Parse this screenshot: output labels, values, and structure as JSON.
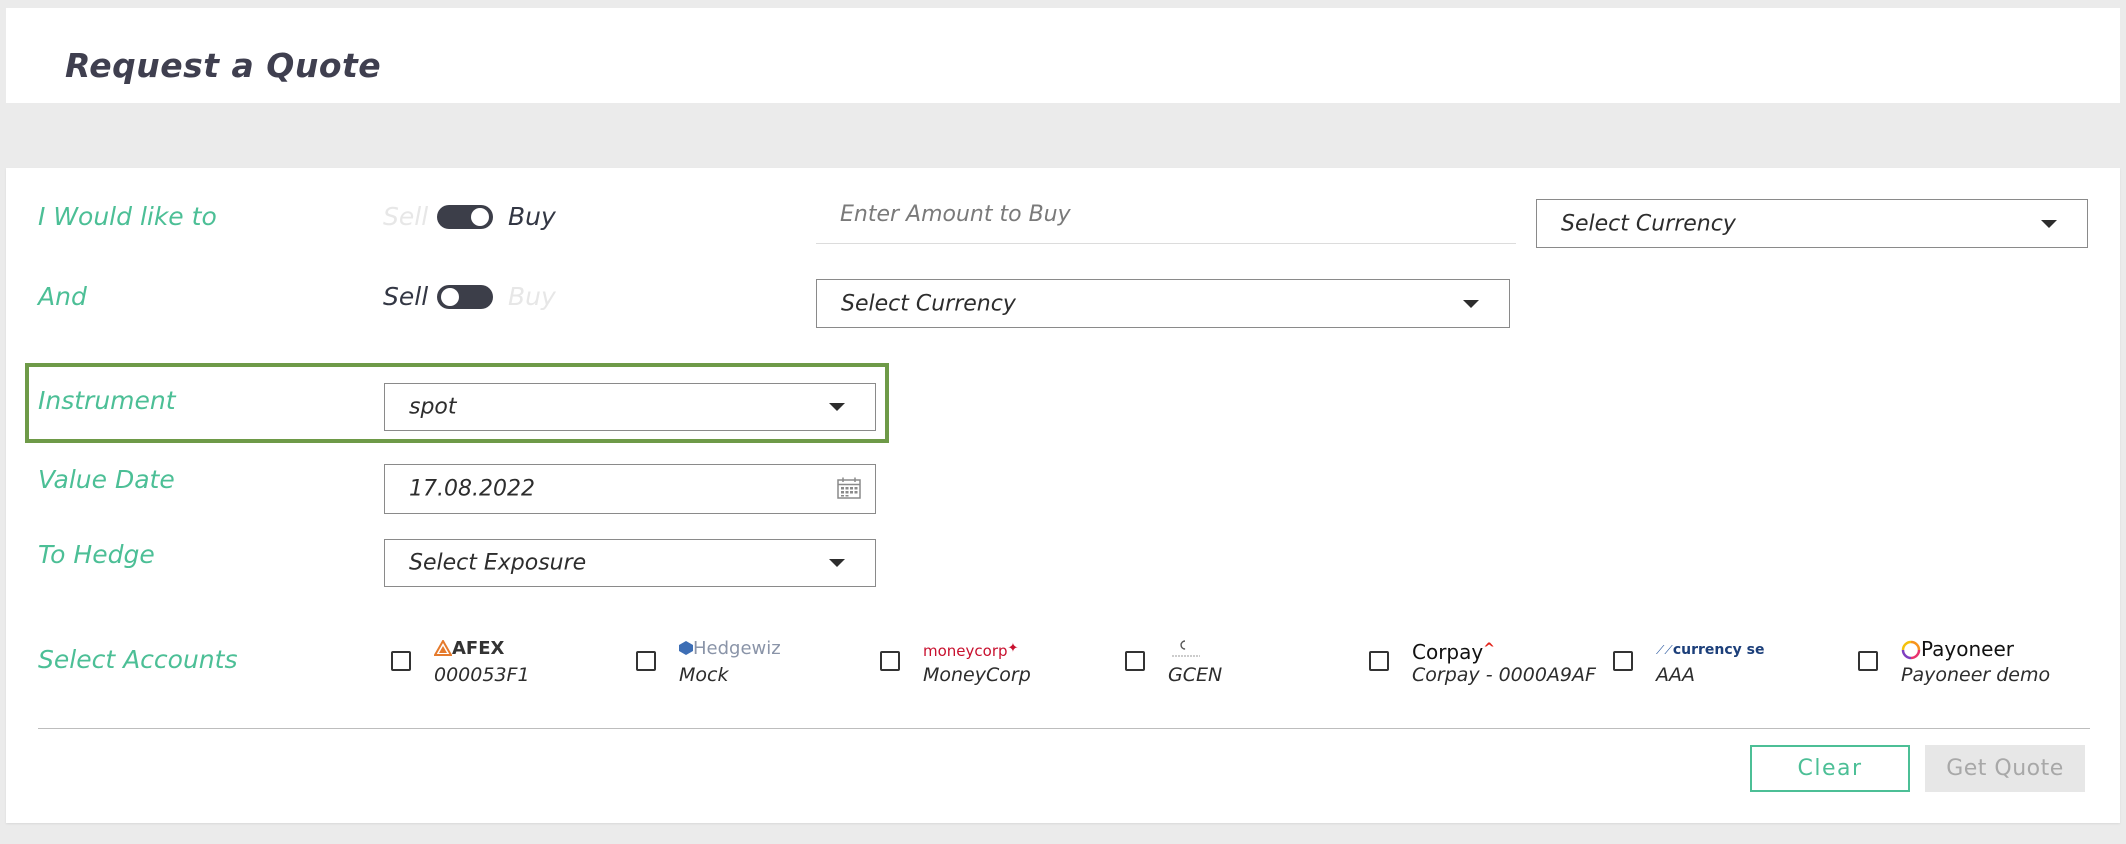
{
  "header": {
    "title": "Request a Quote"
  },
  "form": {
    "row1": {
      "label": "I Would like to",
      "toggle": {
        "left": "Sell",
        "right": "Buy",
        "selected": "Buy"
      },
      "amount_placeholder": "Enter Amount to Buy",
      "currency": "Select Currency"
    },
    "row2": {
      "label": "And",
      "toggle": {
        "left": "Sell",
        "right": "Buy",
        "selected": "Sell"
      },
      "currency": "Select Currency"
    },
    "instrument": {
      "label": "Instrument",
      "value": "spot"
    },
    "value_date": {
      "label": "Value Date",
      "value": "17.08.2022"
    },
    "hedge": {
      "label": "To Hedge",
      "value": "Select Exposure"
    },
    "accounts": {
      "label": "Select Accounts",
      "items": [
        {
          "logo": "AFEX",
          "name": "000053F1",
          "checked": false
        },
        {
          "logo": "Hedgewiz",
          "name": "Mock",
          "checked": false
        },
        {
          "logo": "moneycorp",
          "name": "MoneyCorp",
          "checked": false
        },
        {
          "logo": "",
          "name": "GCEN",
          "checked": false
        },
        {
          "logo": "Corpay",
          "name": "Corpay - 0000A9AF",
          "checked": false
        },
        {
          "logo": "currency se",
          "name": "AAA",
          "checked": false
        },
        {
          "logo": "Payoneer",
          "name": "Payoneer demo",
          "checked": false
        }
      ]
    }
  },
  "actions": {
    "clear": "Clear",
    "get_quote": "Get Quote"
  },
  "colors": {
    "accent": "#4cbf96",
    "highlight": "#6e9a48",
    "toggle": "#3c3e49",
    "title": "#3f3f4f"
  }
}
